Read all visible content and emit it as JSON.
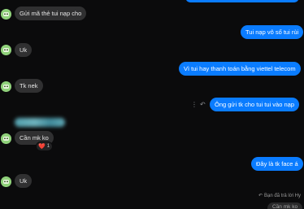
{
  "colors": {
    "background": "#0b0b0c",
    "incoming_bubble": "#303031",
    "outgoing_bubble": "#0a7cff",
    "avatar": "#8fd07a"
  },
  "messages": [
    {
      "side": "in",
      "text": "Gửi mã thẻ tui nạp cho"
    },
    {
      "side": "out",
      "text": "Tui nạp vô số tui rùi"
    },
    {
      "side": "in",
      "text": "Uk"
    },
    {
      "side": "out",
      "text": "Vì tui hay thanh toán bằng viettel telecom"
    },
    {
      "side": "in",
      "text": "Tk nek"
    },
    {
      "side": "out",
      "text": "Ông gửi tk cho tui tui vào nạp"
    },
    {
      "side": "in",
      "text": "Cần mk ko"
    },
    {
      "side": "out",
      "text": "Đây là tk face á"
    },
    {
      "side": "in",
      "text": "Uk"
    }
  ],
  "reaction": {
    "icon": "heart",
    "emoji": "❤️",
    "count": "1"
  },
  "message_actions": {
    "more": "⋮",
    "reply": "↶"
  },
  "reply_note": {
    "icon": "↶",
    "text": "Bạn đã trả lời Hy"
  },
  "quoted_message": "Cần mk ko"
}
